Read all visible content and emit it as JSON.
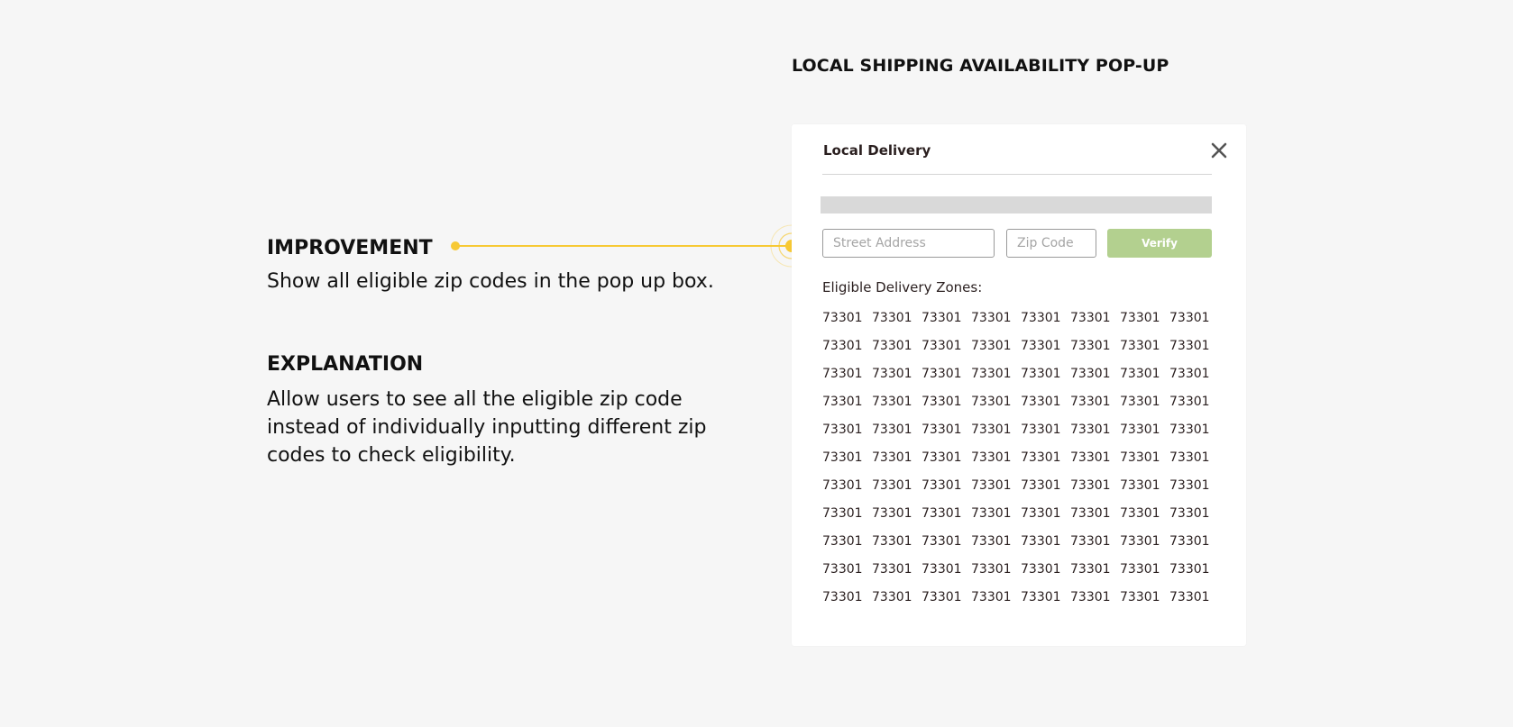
{
  "heading": "LOCAL SHIPPING AVAILABILITY POP-UP",
  "improvement": {
    "title": "IMPROVEMENT",
    "text": "Show all eligible zip codes in the pop up box."
  },
  "explanation": {
    "title": "EXPLANATION",
    "text": "Allow users to see all the eligible zip code instead of individually inputting different zip codes to check eligibility."
  },
  "colors": {
    "background": "#f6f6f6",
    "accent_yellow": "#f7c934",
    "verify_green": "#b3d08f",
    "text_dark": "#2a1f1f"
  },
  "popup": {
    "title": "Local Delivery",
    "close_icon": "close-x-icon",
    "street_placeholder": "Street Address",
    "zip_placeholder": "Zip Code",
    "verify_label": "Verify",
    "zones_label": "Eligible Delivery Zones:",
    "zip_codes": [
      [
        "73301",
        "73301",
        "73301",
        "73301",
        "73301",
        "73301",
        "73301",
        "73301"
      ],
      [
        "73301",
        "73301",
        "73301",
        "73301",
        "73301",
        "73301",
        "73301",
        "73301"
      ],
      [
        "73301",
        "73301",
        "73301",
        "73301",
        "73301",
        "73301",
        "73301",
        "73301"
      ],
      [
        "73301",
        "73301",
        "73301",
        "73301",
        "73301",
        "73301",
        "73301",
        "73301"
      ],
      [
        "73301",
        "73301",
        "73301",
        "73301",
        "73301",
        "73301",
        "73301",
        "73301"
      ],
      [
        "73301",
        "73301",
        "73301",
        "73301",
        "73301",
        "73301",
        "73301",
        "73301"
      ],
      [
        "73301",
        "73301",
        "73301",
        "73301",
        "73301",
        "73301",
        "73301",
        "73301"
      ],
      [
        "73301",
        "73301",
        "73301",
        "73301",
        "73301",
        "73301",
        "73301",
        "73301"
      ],
      [
        "73301",
        "73301",
        "73301",
        "73301",
        "73301",
        "73301",
        "73301",
        "73301"
      ],
      [
        "73301",
        "73301",
        "73301",
        "73301",
        "73301",
        "73301",
        "73301",
        "73301"
      ],
      [
        "73301",
        "73301",
        "73301",
        "73301",
        "73301",
        "73301",
        "73301",
        "73301"
      ]
    ]
  }
}
